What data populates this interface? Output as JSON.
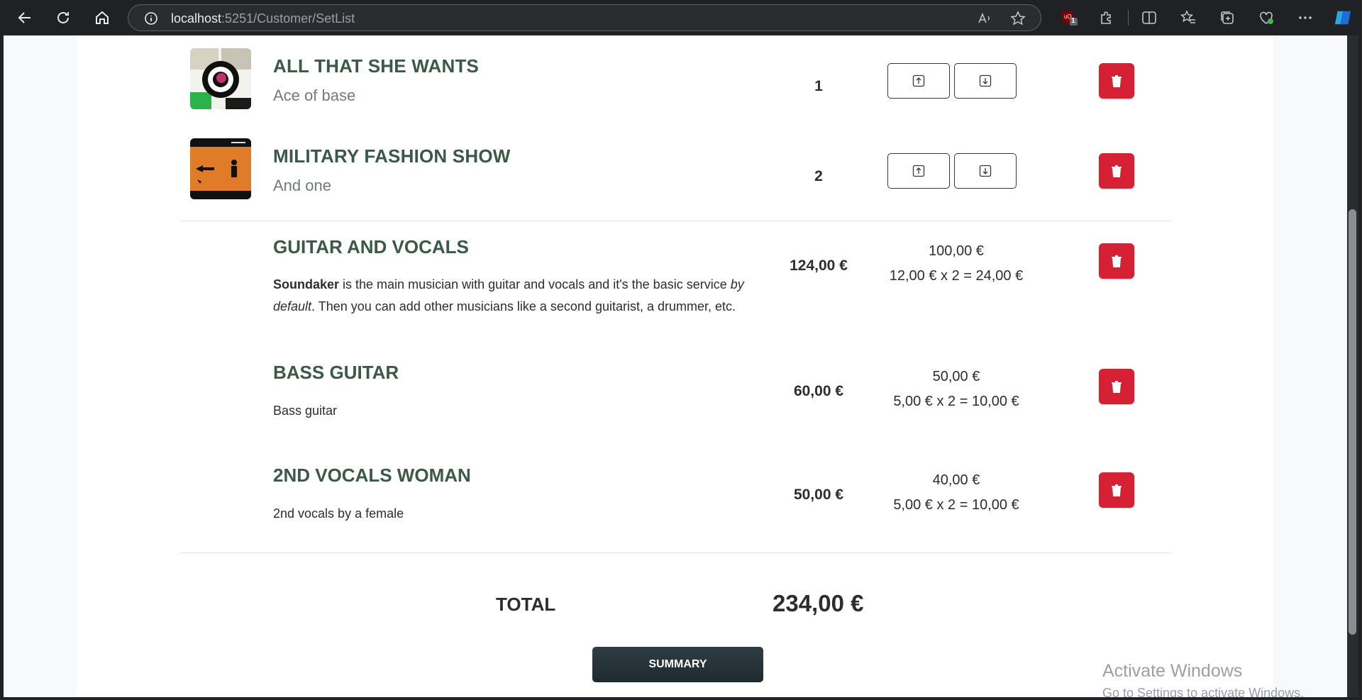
{
  "browser": {
    "url_host": "localhost",
    "url_path": ":5251/Customer/SetList",
    "extension_badge": "1"
  },
  "songs": [
    {
      "title": "ALL THAT SHE WANTS",
      "artist": "Ace of base",
      "position": "1"
    },
    {
      "title": "MILITARY FASHION SHOW",
      "artist": "And one",
      "position": "2"
    }
  ],
  "services": [
    {
      "title": "GUITAR AND VOCALS",
      "desc_bold": "Soundaker",
      "desc_part1": " is the main musician with guitar and vocals and it's the basic service ",
      "desc_italic": "by default",
      "desc_part2": ". Then you can add other musicians like a second guitarist, a drummer, etc.",
      "price": "124,00 €",
      "base": "100,00 €",
      "calc": "12,00 € x 2 = 24,00 €"
    },
    {
      "title": "BASS GUITAR",
      "desc": "Bass guitar",
      "price": "60,00 €",
      "base": "50,00 €",
      "calc": "5,00 € x 2 = 10,00 €"
    },
    {
      "title": "2ND VOCALS WOMAN",
      "desc": "2nd vocals by a female",
      "price": "50,00 €",
      "base": "40,00 €",
      "calc": "5,00 € x 2 = 10,00 €"
    }
  ],
  "total": {
    "label": "TOTAL",
    "value": "234,00 €"
  },
  "summary_button": "SUMMARY",
  "watermark": {
    "line1": "Activate Windows",
    "line2": "Go to Settings to activate Windows."
  },
  "colors": {
    "title_green": "#3a5948",
    "delete_red": "#d62034",
    "button_dark": "#2a363c"
  }
}
